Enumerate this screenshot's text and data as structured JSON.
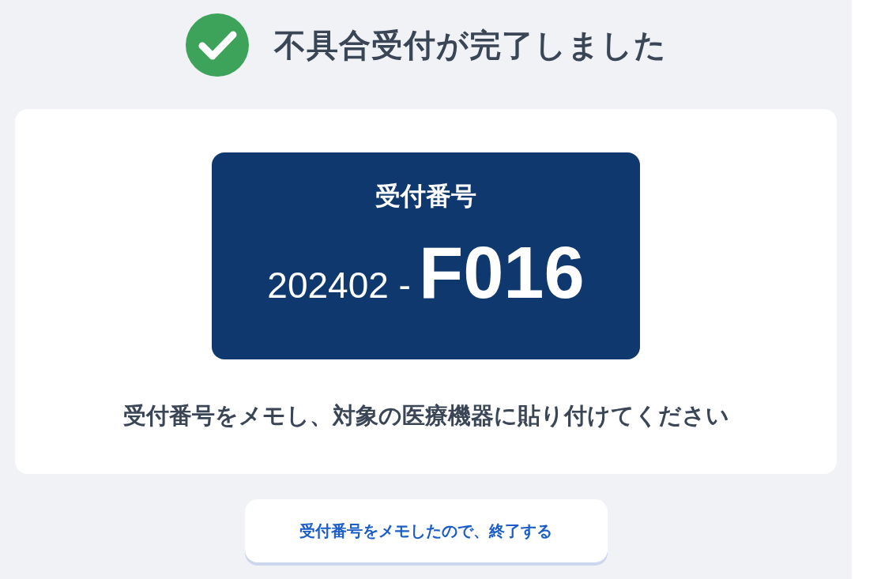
{
  "header": {
    "title": "不具合受付が完了しました"
  },
  "receipt": {
    "label": "受付番号",
    "number_prefix": "202402 -",
    "number_main": "F016"
  },
  "instruction": "受付番号をメモし、対象の医療機器に貼り付けてください",
  "button": {
    "label": "受付番号をメモしたので、終了する"
  }
}
